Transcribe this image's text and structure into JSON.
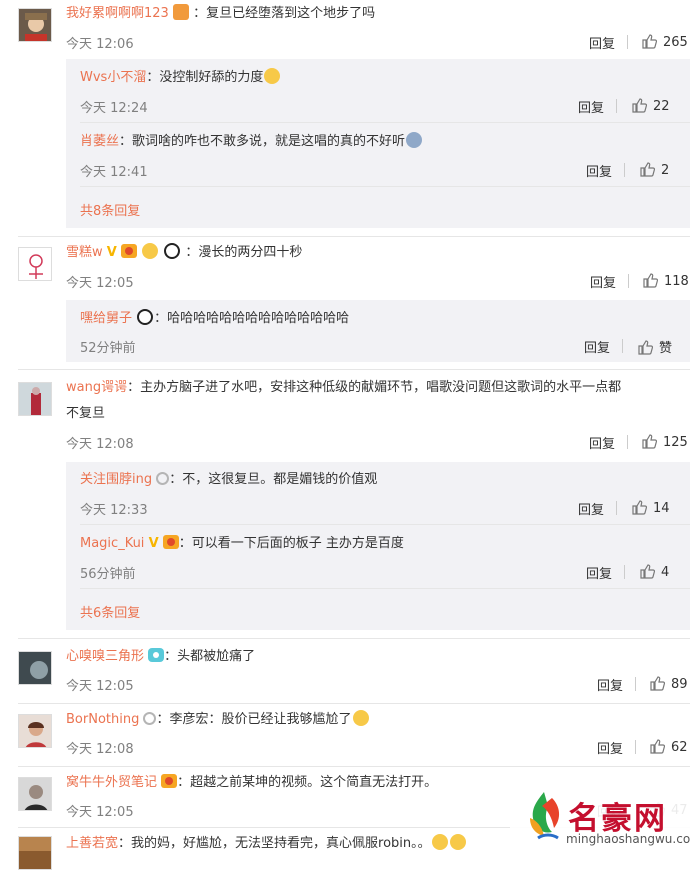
{
  "labels": {
    "reply": "回复",
    "like_word": "赞"
  },
  "comments": [
    {
      "user": "我好累啊啊啊123",
      "text": "：复旦已经堕落到这个地步了吗",
      "time": "今天 12:06",
      "likes": "265",
      "replies": [
        {
          "user": "Wvs小不溜",
          "text": "：没控制好舔的力度",
          "time": "今天 12:24",
          "likes": "22"
        },
        {
          "user": "肖萎丝",
          "text": "：歌词啥的咋也不敢多说，就是这唱的真的不好听",
          "time": "今天 12:41",
          "likes": "2"
        }
      ],
      "more": "共8条回复"
    },
    {
      "user": "雪糕w",
      "text": "：漫长的两分四十秒",
      "time": "今天 12:05",
      "likes": "118",
      "replies": [
        {
          "user": "嘿给舅子",
          "text": "：哈哈哈哈哈哈哈哈哈哈哈哈哈哈",
          "time": "52分钟前",
          "likes": "赞"
        }
      ]
    },
    {
      "user": "wang谔谔",
      "text": "：主办方脑子进了水吧，安排这种低级的献媚环节，唱歌没问题但这歌词的水平一点都",
      "text2": "不复旦",
      "time": "今天 12:08",
      "likes": "125",
      "replies": [
        {
          "user": "关注围脖ing",
          "text": "：不，这很复旦。都是媚钱的价值观",
          "time": "今天 12:33",
          "likes": "14"
        },
        {
          "user": "Magic_Kui",
          "text": "：可以看一下后面的板子 主办方是百度",
          "time": "56分钟前",
          "likes": "4"
        }
      ],
      "more": "共6条回复"
    },
    {
      "user": "心嗅嗅三角形",
      "text": "：头都被尬痛了",
      "time": "今天 12:05",
      "likes": "89"
    },
    {
      "user": "BorNothing",
      "text": "：李彦宏：股价已经让我够尴尬了",
      "time": "今天 12:08",
      "likes": "62"
    },
    {
      "user": "窝牛牛外贸笔记",
      "text": "：超越之前某坤的视频。这个简直无法打开。",
      "time": "今天 12:05",
      "likes": "47"
    },
    {
      "user": "上善若宽",
      "text": "：我的妈，好尴尬，无法坚持看完，真心佩服robin。。"
    }
  ],
  "watermark": {
    "cn": "名豪网",
    "url": "minghaoshangwu.com"
  },
  "colors": {
    "username": "#eb7350",
    "reply_bg": "#f2f2f5",
    "meta": "#808080"
  }
}
